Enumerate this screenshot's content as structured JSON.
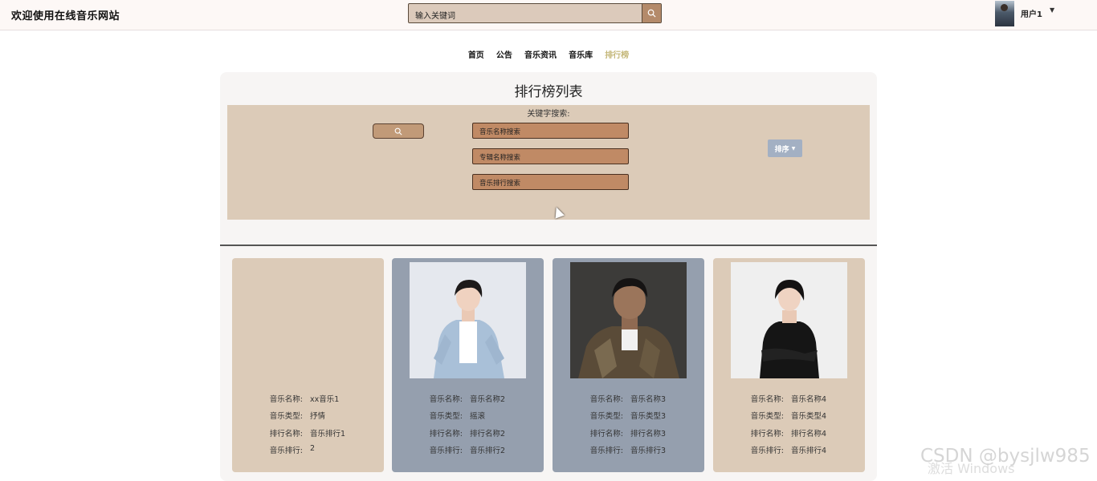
{
  "header": {
    "site_title": "欢迎使用在线音乐网站",
    "search_placeholder": "输入关键词",
    "user_name": "用户1"
  },
  "nav": {
    "items": [
      "首页",
      "公告",
      "音乐资讯",
      "音乐库",
      "排行榜"
    ],
    "active_index": 4
  },
  "panel": {
    "title": "排行榜列表",
    "keyword_label": "关键字搜索:",
    "fields": [
      "音乐名称搜索",
      "专辑名称搜索",
      "音乐排行搜索"
    ],
    "sort_label": "排序"
  },
  "cards": [
    {
      "rows": [
        {
          "k": "音乐名称:",
          "v": "xx音乐1"
        },
        {
          "k": "音乐类型:",
          "v": "抒情"
        },
        {
          "k": "排行名称:",
          "v": "音乐排行1"
        },
        {
          "k": "音乐排行:",
          "v": "2"
        }
      ]
    },
    {
      "rows": [
        {
          "k": "音乐名称:",
          "v": "音乐名称2"
        },
        {
          "k": "音乐类型:",
          "v": "摇滚"
        },
        {
          "k": "排行名称:",
          "v": "排行名称2"
        },
        {
          "k": "音乐排行:",
          "v": "音乐排行2"
        }
      ]
    },
    {
      "rows": [
        {
          "k": "音乐名称:",
          "v": "音乐名称3"
        },
        {
          "k": "音乐类型:",
          "v": "音乐类型3"
        },
        {
          "k": "排行名称:",
          "v": "排行名称3"
        },
        {
          "k": "音乐排行:",
          "v": "音乐排行3"
        }
      ]
    },
    {
      "rows": [
        {
          "k": "音乐名称:",
          "v": "音乐名称4"
        },
        {
          "k": "音乐类型:",
          "v": "音乐类型4"
        },
        {
          "k": "排行名称:",
          "v": "排行名称4"
        },
        {
          "k": "音乐排行:",
          "v": "音乐排行4"
        }
      ]
    }
  ],
  "watermark": {
    "csdn": "CSDN @bysjlw985",
    "windows": "激活 Windows"
  }
}
